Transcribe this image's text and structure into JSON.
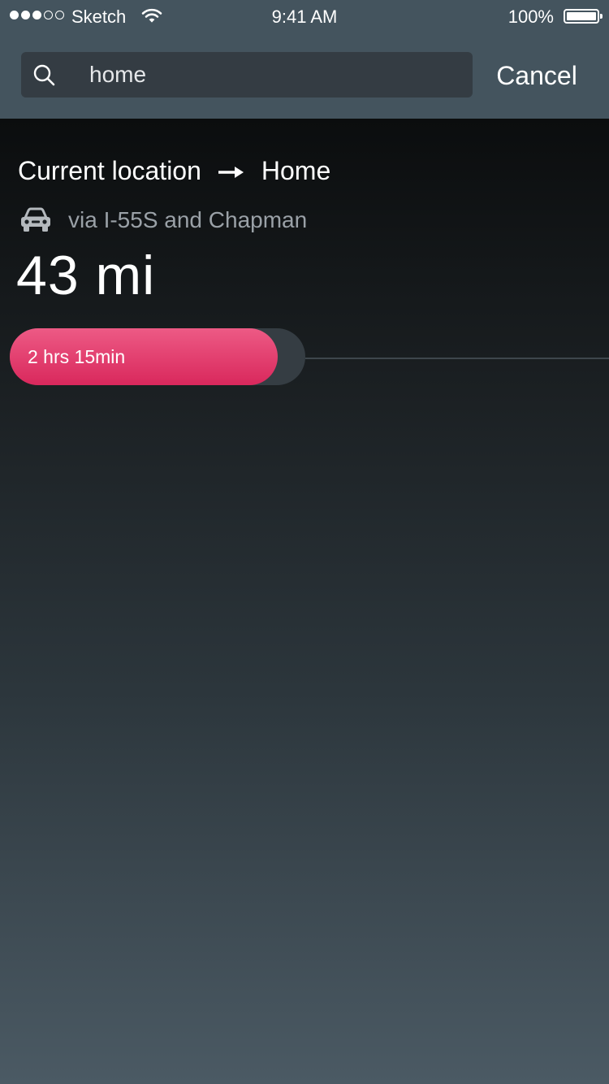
{
  "status_bar": {
    "carrier": "Sketch",
    "time": "9:41 AM",
    "battery": "100%"
  },
  "search": {
    "value": "home",
    "cancel_label": "Cancel"
  },
  "route": {
    "origin": "Current location",
    "destination": "Home",
    "via": "via I-55S and Chapman",
    "distance": "43 mi",
    "duration": "2 hrs 15min"
  },
  "colors": {
    "accent": "#e33d6e",
    "header_bg": "#44545e",
    "search_bg": "#343c43",
    "secondary_text": "#9aa1a7"
  },
  "icons": {
    "search": "search-icon",
    "route_arrow": "arrow-right-icon",
    "transport": "car-icon",
    "wifi": "wifi-icon",
    "battery": "battery-icon"
  }
}
